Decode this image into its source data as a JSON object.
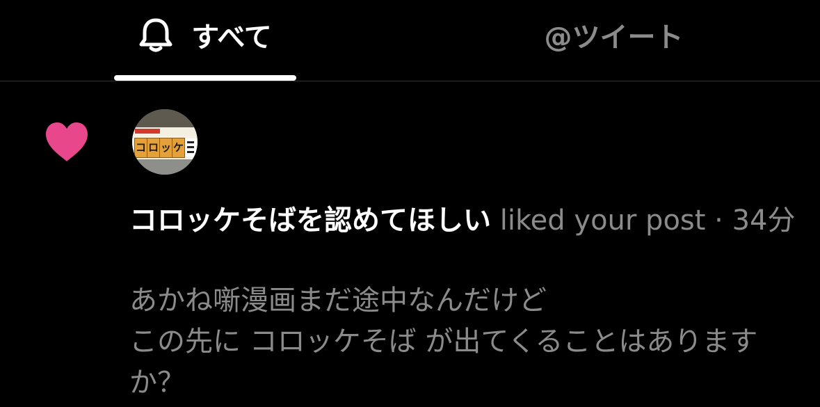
{
  "tabs": {
    "all_label": "すべて",
    "mentions_label": "@ツイート"
  },
  "notification": {
    "icon": "heart-icon",
    "heart_color": "#e8488b",
    "user_name": "コロッケそばを認めてほしい",
    "action": "liked your post",
    "separator": "·",
    "time_ago": "34分",
    "post_line_1": "あかね噺漫画まだ途中なんだけど",
    "post_line_2": "この先に コロッケそば が出てくることはありますか？",
    "avatar_sign_glyphs": [
      "コ",
      "ロ",
      "ッ",
      "ケ"
    ]
  }
}
